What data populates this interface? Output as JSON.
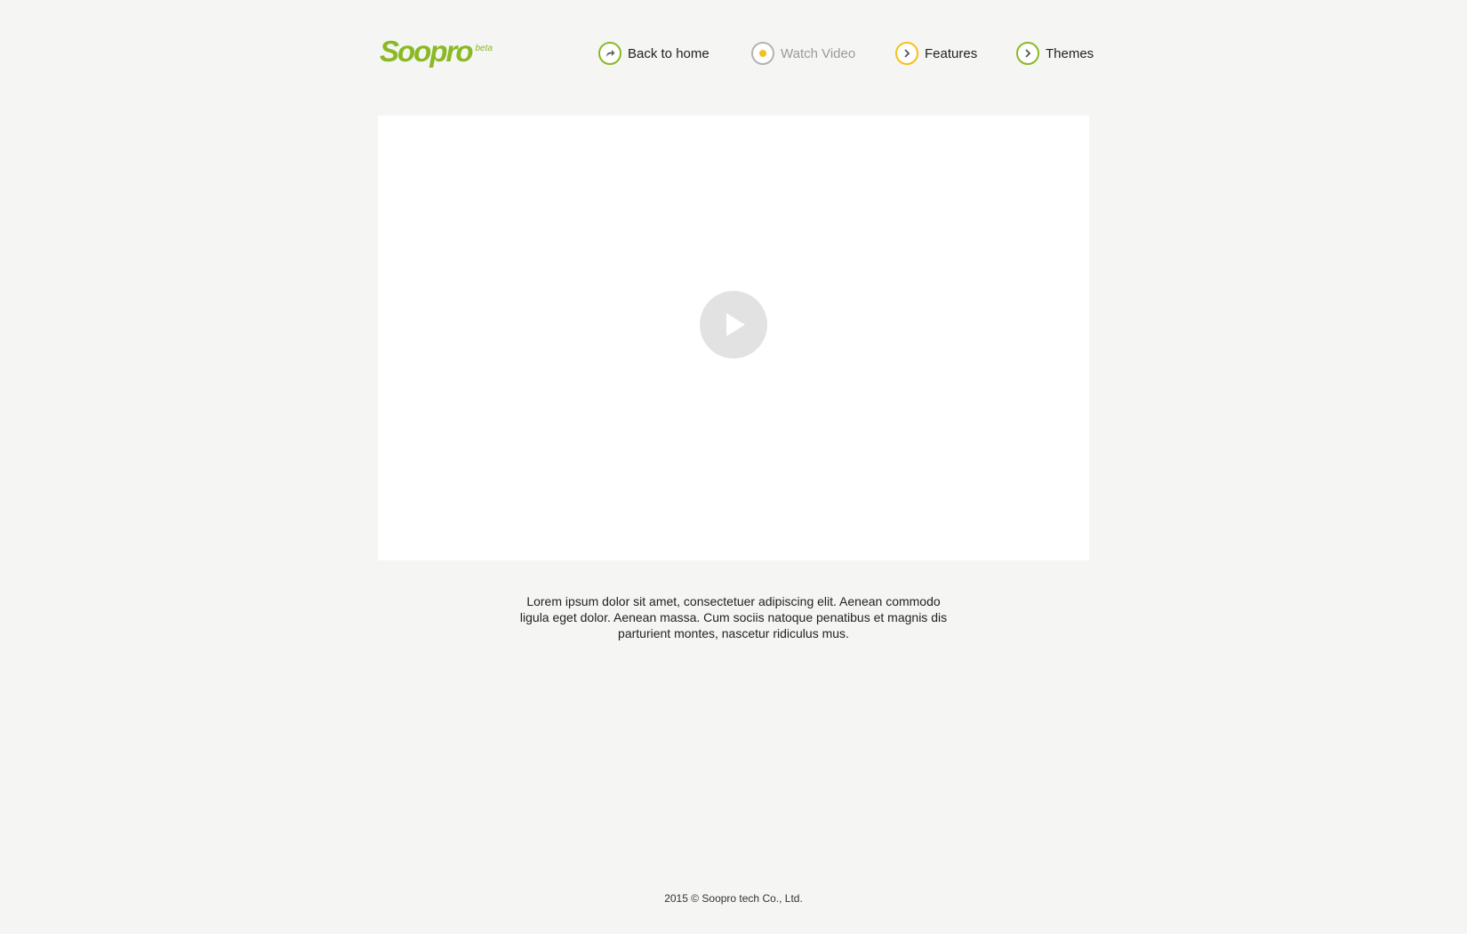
{
  "brand": {
    "name": "Soopro",
    "tag": "beta",
    "color": "#8ab924"
  },
  "nav": {
    "items": [
      {
        "label": "Back to home",
        "icon": "share-arrow-icon",
        "ring_color": "#8ab924"
      },
      {
        "label": "Watch Video",
        "icon": "dot-icon",
        "ring_color": "#b3b3b3",
        "active": true
      },
      {
        "label": "Features",
        "icon": "chevron-right-icon",
        "ring_color": "#f2c21b"
      },
      {
        "label": "Themes",
        "icon": "chevron-right-icon",
        "ring_color": "#8ab924"
      }
    ]
  },
  "video": {
    "play_icon": "play-icon"
  },
  "description": "Lorem ipsum dolor sit amet, consectetuer adipiscing elit. Aenean commodo ligula eget dolor. Aenean massa. Cum sociis natoque penatibus et magnis dis parturient montes, nascetur ridiculus mus.",
  "footer": {
    "copyright": "2015 © Soopro tech Co., Ltd."
  }
}
